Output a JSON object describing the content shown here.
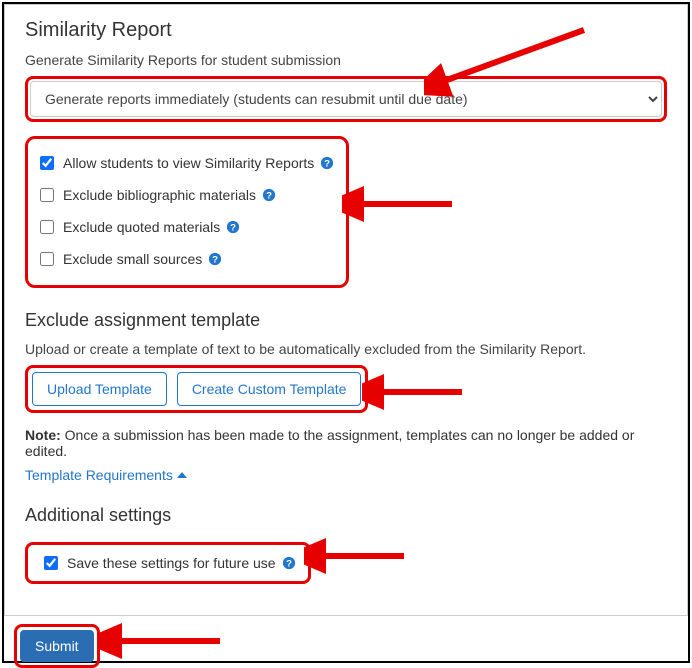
{
  "similarity": {
    "heading": "Similarity Report",
    "desc": "Generate Similarity Reports for student submission",
    "select_value": "Generate reports immediately (students can resubmit until due date)",
    "options": {
      "allow_view": {
        "label": "Allow students to view Similarity Reports",
        "checked": true
      },
      "exclude_bib": {
        "label": "Exclude bibliographic materials",
        "checked": false
      },
      "exclude_quoted": {
        "label": "Exclude quoted materials",
        "checked": false
      },
      "exclude_small": {
        "label": "Exclude small sources",
        "checked": false
      }
    }
  },
  "exclude_template": {
    "heading": "Exclude assignment template",
    "desc": "Upload or create a template of text to be automatically excluded from the Similarity Report.",
    "upload_btn": "Upload Template",
    "create_btn": "Create Custom Template",
    "note_bold": "Note:",
    "note_text": " Once a submission has been made to the assignment, templates can no longer be added or edited.",
    "requirements_link": "Template Requirements"
  },
  "additional": {
    "heading": "Additional settings",
    "save_label": "Save these settings for future use",
    "save_checked": true
  },
  "submit_label": "Submit"
}
